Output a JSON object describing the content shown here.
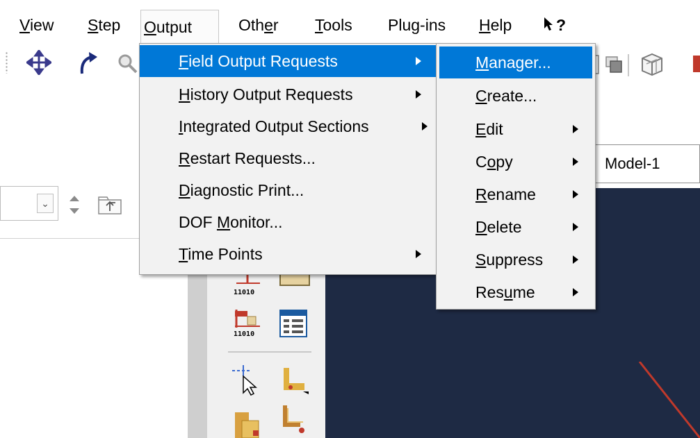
{
  "menubar": {
    "items": [
      {
        "pre": "",
        "acc": "V",
        "post": "iew"
      },
      {
        "pre": "",
        "acc": "S",
        "post": "tep"
      },
      {
        "pre": "",
        "acc": "O",
        "post": "utput"
      },
      {
        "pre": "Oth",
        "acc": "e",
        "post": "r"
      },
      {
        "pre": "",
        "acc": "T",
        "post": "ools"
      },
      {
        "pre": "Plu",
        "acc": "g",
        "post": "-ins"
      },
      {
        "pre": "",
        "acc": "H",
        "post": "elp"
      }
    ],
    "whats_this": "?"
  },
  "output_menu": {
    "items": [
      {
        "pre": "",
        "acc": "F",
        "post": "ield Output Requests",
        "has_submenu": true
      },
      {
        "pre": "",
        "acc": "H",
        "post": "istory Output Requests",
        "has_submenu": true
      },
      {
        "pre": "",
        "acc": "I",
        "post": "ntegrated Output Sections",
        "has_submenu": true
      },
      {
        "pre": "",
        "acc": "R",
        "post": "estart Requests...",
        "has_submenu": false
      },
      {
        "pre": "",
        "acc": "D",
        "post": "iagnostic Print...",
        "has_submenu": false
      },
      {
        "pre": "DOF ",
        "acc": "M",
        "post": "onitor...",
        "has_submenu": false
      },
      {
        "pre": "",
        "acc": "T",
        "post": "ime Points",
        "has_submenu": true
      }
    ]
  },
  "field_submenu": {
    "items": [
      {
        "pre": "",
        "acc": "M",
        "post": "anager...",
        "has_submenu": false
      },
      {
        "pre": "",
        "acc": "C",
        "post": "reate...",
        "has_submenu": false
      },
      {
        "pre": "",
        "acc": "E",
        "post": "dit",
        "has_submenu": true
      },
      {
        "pre": "C",
        "acc": "o",
        "post": "py",
        "has_submenu": true
      },
      {
        "pre": "",
        "acc": "R",
        "post": "ename",
        "has_submenu": true
      },
      {
        "pre": "",
        "acc": "D",
        "post": "elete",
        "has_submenu": true
      },
      {
        "pre": "",
        "acc": "S",
        "post": "uppress",
        "has_submenu": true
      },
      {
        "pre": "Res",
        "acc": "u",
        "post": "me",
        "has_submenu": true
      }
    ]
  },
  "model_combo": {
    "value": "Model-1"
  },
  "toolbox": {
    "icon_caption": "11010"
  },
  "colors": {
    "highlight": "#0078d7",
    "viewport_bg": "#1e2a44",
    "menu_bg": "#f2f2f2"
  },
  "icons": [
    "pan-icon",
    "rotate-icon",
    "zoom-icon",
    "whats-this-icon",
    "select-box-icon",
    "render-icon",
    "spinner-icon",
    "parent-folder-icon"
  ]
}
